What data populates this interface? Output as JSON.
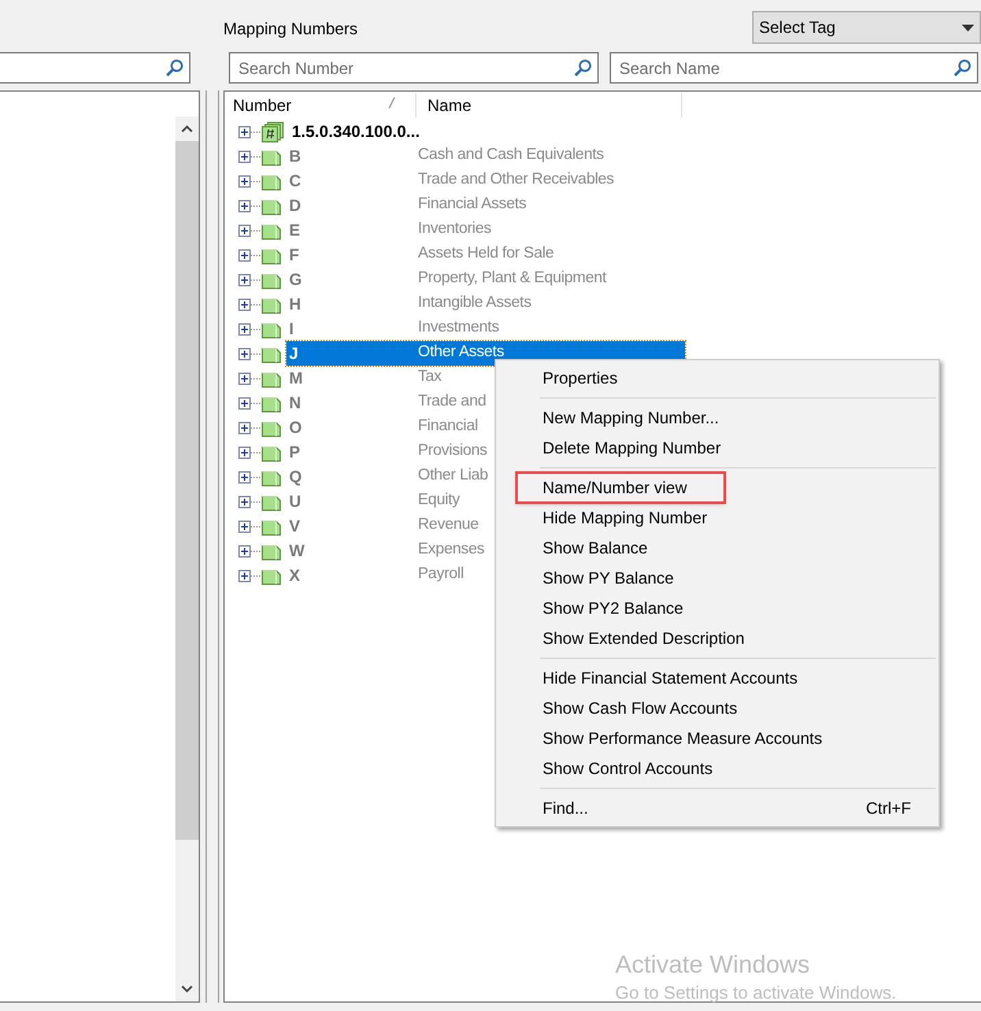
{
  "header": {
    "title": "Mapping Numbers",
    "tag_select": "Select Tag"
  },
  "search": {
    "number_placeholder": "Search Number",
    "name_placeholder": "Search Name"
  },
  "columns": [
    "Number",
    "Name"
  ],
  "rows": [
    {
      "kind": "root",
      "number": "1.5.0.340.100.0...",
      "name": "",
      "selected": false
    },
    {
      "kind": "group",
      "number": "B",
      "name": "Cash and Cash Equivalents",
      "selected": false
    },
    {
      "kind": "group",
      "number": "C",
      "name": "Trade and Other Receivables",
      "selected": false
    },
    {
      "kind": "group",
      "number": "D",
      "name": "Financial Assets",
      "selected": false
    },
    {
      "kind": "group",
      "number": "E",
      "name": "Inventories",
      "selected": false
    },
    {
      "kind": "group",
      "number": "F",
      "name": "Assets Held for Sale",
      "selected": false
    },
    {
      "kind": "group",
      "number": "G",
      "name": "Property, Plant & Equipment",
      "selected": false
    },
    {
      "kind": "group",
      "number": "H",
      "name": "Intangible Assets",
      "selected": false
    },
    {
      "kind": "group",
      "number": "I",
      "name": "Investments",
      "selected": false
    },
    {
      "kind": "group",
      "number": "J",
      "name": "Other Assets",
      "selected": true
    },
    {
      "kind": "group",
      "number": "M",
      "name": "Tax",
      "selected": false
    },
    {
      "kind": "group",
      "number": "N",
      "name": "Trade and",
      "selected": false
    },
    {
      "kind": "group",
      "number": "O",
      "name": "Financial",
      "selected": false
    },
    {
      "kind": "group",
      "number": "P",
      "name": "Provisions",
      "selected": false
    },
    {
      "kind": "group",
      "number": "Q",
      "name": "Other Liab",
      "selected": false
    },
    {
      "kind": "group",
      "number": "U",
      "name": "Equity",
      "selected": false
    },
    {
      "kind": "group",
      "number": "V",
      "name": "Revenue",
      "selected": false
    },
    {
      "kind": "group",
      "number": "W",
      "name": "Expenses",
      "selected": false
    },
    {
      "kind": "group",
      "number": "X",
      "name": "Payroll",
      "selected": false
    }
  ],
  "context_menu": [
    {
      "kind": "item",
      "label": "Properties",
      "annotated": false
    },
    {
      "kind": "separator"
    },
    {
      "kind": "item",
      "label": "New Mapping Number...",
      "annotated": false
    },
    {
      "kind": "item",
      "label": "Delete Mapping Number",
      "annotated": false
    },
    {
      "kind": "separator"
    },
    {
      "kind": "item",
      "label": "Name/Number view",
      "annotated": true
    },
    {
      "kind": "item",
      "label": "Hide Mapping Number",
      "annotated": false
    },
    {
      "kind": "item",
      "label": "Show Balance",
      "annotated": false
    },
    {
      "kind": "item",
      "label": "Show PY Balance",
      "annotated": false
    },
    {
      "kind": "item",
      "label": "Show PY2 Balance",
      "annotated": false
    },
    {
      "kind": "item",
      "label": "Show Extended Description",
      "annotated": false
    },
    {
      "kind": "separator"
    },
    {
      "kind": "item",
      "label": "Hide Financial Statement Accounts",
      "annotated": false
    },
    {
      "kind": "item",
      "label": "Show Cash Flow Accounts",
      "annotated": false
    },
    {
      "kind": "item",
      "label": "Show Performance Measure Accounts",
      "annotated": false
    },
    {
      "kind": "item",
      "label": "Show Control Accounts",
      "annotated": false
    },
    {
      "kind": "separator"
    },
    {
      "kind": "item",
      "label": "Find...",
      "shortcut": "Ctrl+F",
      "annotated": false
    }
  ],
  "activation_notice": {
    "title": "Activate Windows",
    "subtitle": "Go to Settings to activate Windows."
  }
}
